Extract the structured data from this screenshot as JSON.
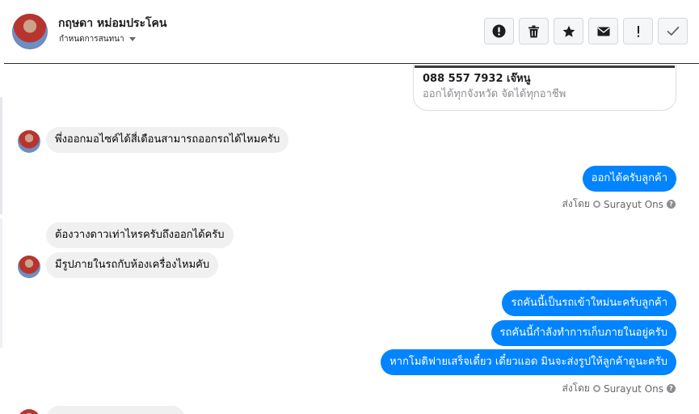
{
  "header": {
    "contact_name": "กฤษดา หม่อมประโคน",
    "status_label": "กำหนดการสนทนา",
    "toolbar_icons": [
      "spam-icon",
      "trash-icon",
      "star-icon",
      "envelope-icon",
      "exclamation-icon",
      "check-icon"
    ]
  },
  "card": {
    "title": "088 557 7932 เจ๊หนู",
    "subtitle": "ออกได้ทุกจังหวัด จัดได้ทุกอาชีพ"
  },
  "messages": {
    "in_1": "พึ่งออกมอไซค์ได้สี่เดือนสามารถออกรถได้ไหมครับ",
    "out_1": "ออกได้ครับลูกค้า",
    "in_2": "ต้องวางดาวเท่าไหรครับถึงออกได้ครับ",
    "in_3": "มีรูปภายในรถกับห้องเครื่องไหมคับ",
    "out_2": "รถคันนี้เป็นรถเข้าใหม่นะครับลูกค้า",
    "out_3": "รถคันนี้กำลังทำการเก็บภายในอยู่ครับ",
    "out_4": "หากโมดิฟายเสร็จเดี๋ยว เดี๋ยวแอด มินจะส่งรูปให้ลูกค้าดูนะครับ"
  },
  "sent_by": {
    "prefix": "ส่งโดย",
    "name": "Surayut Ons",
    "help": "?"
  },
  "colors": {
    "outgoing_bubble": "#0084ff",
    "incoming_bubble": "#f0f0f0",
    "muted_text": "#65676b"
  }
}
